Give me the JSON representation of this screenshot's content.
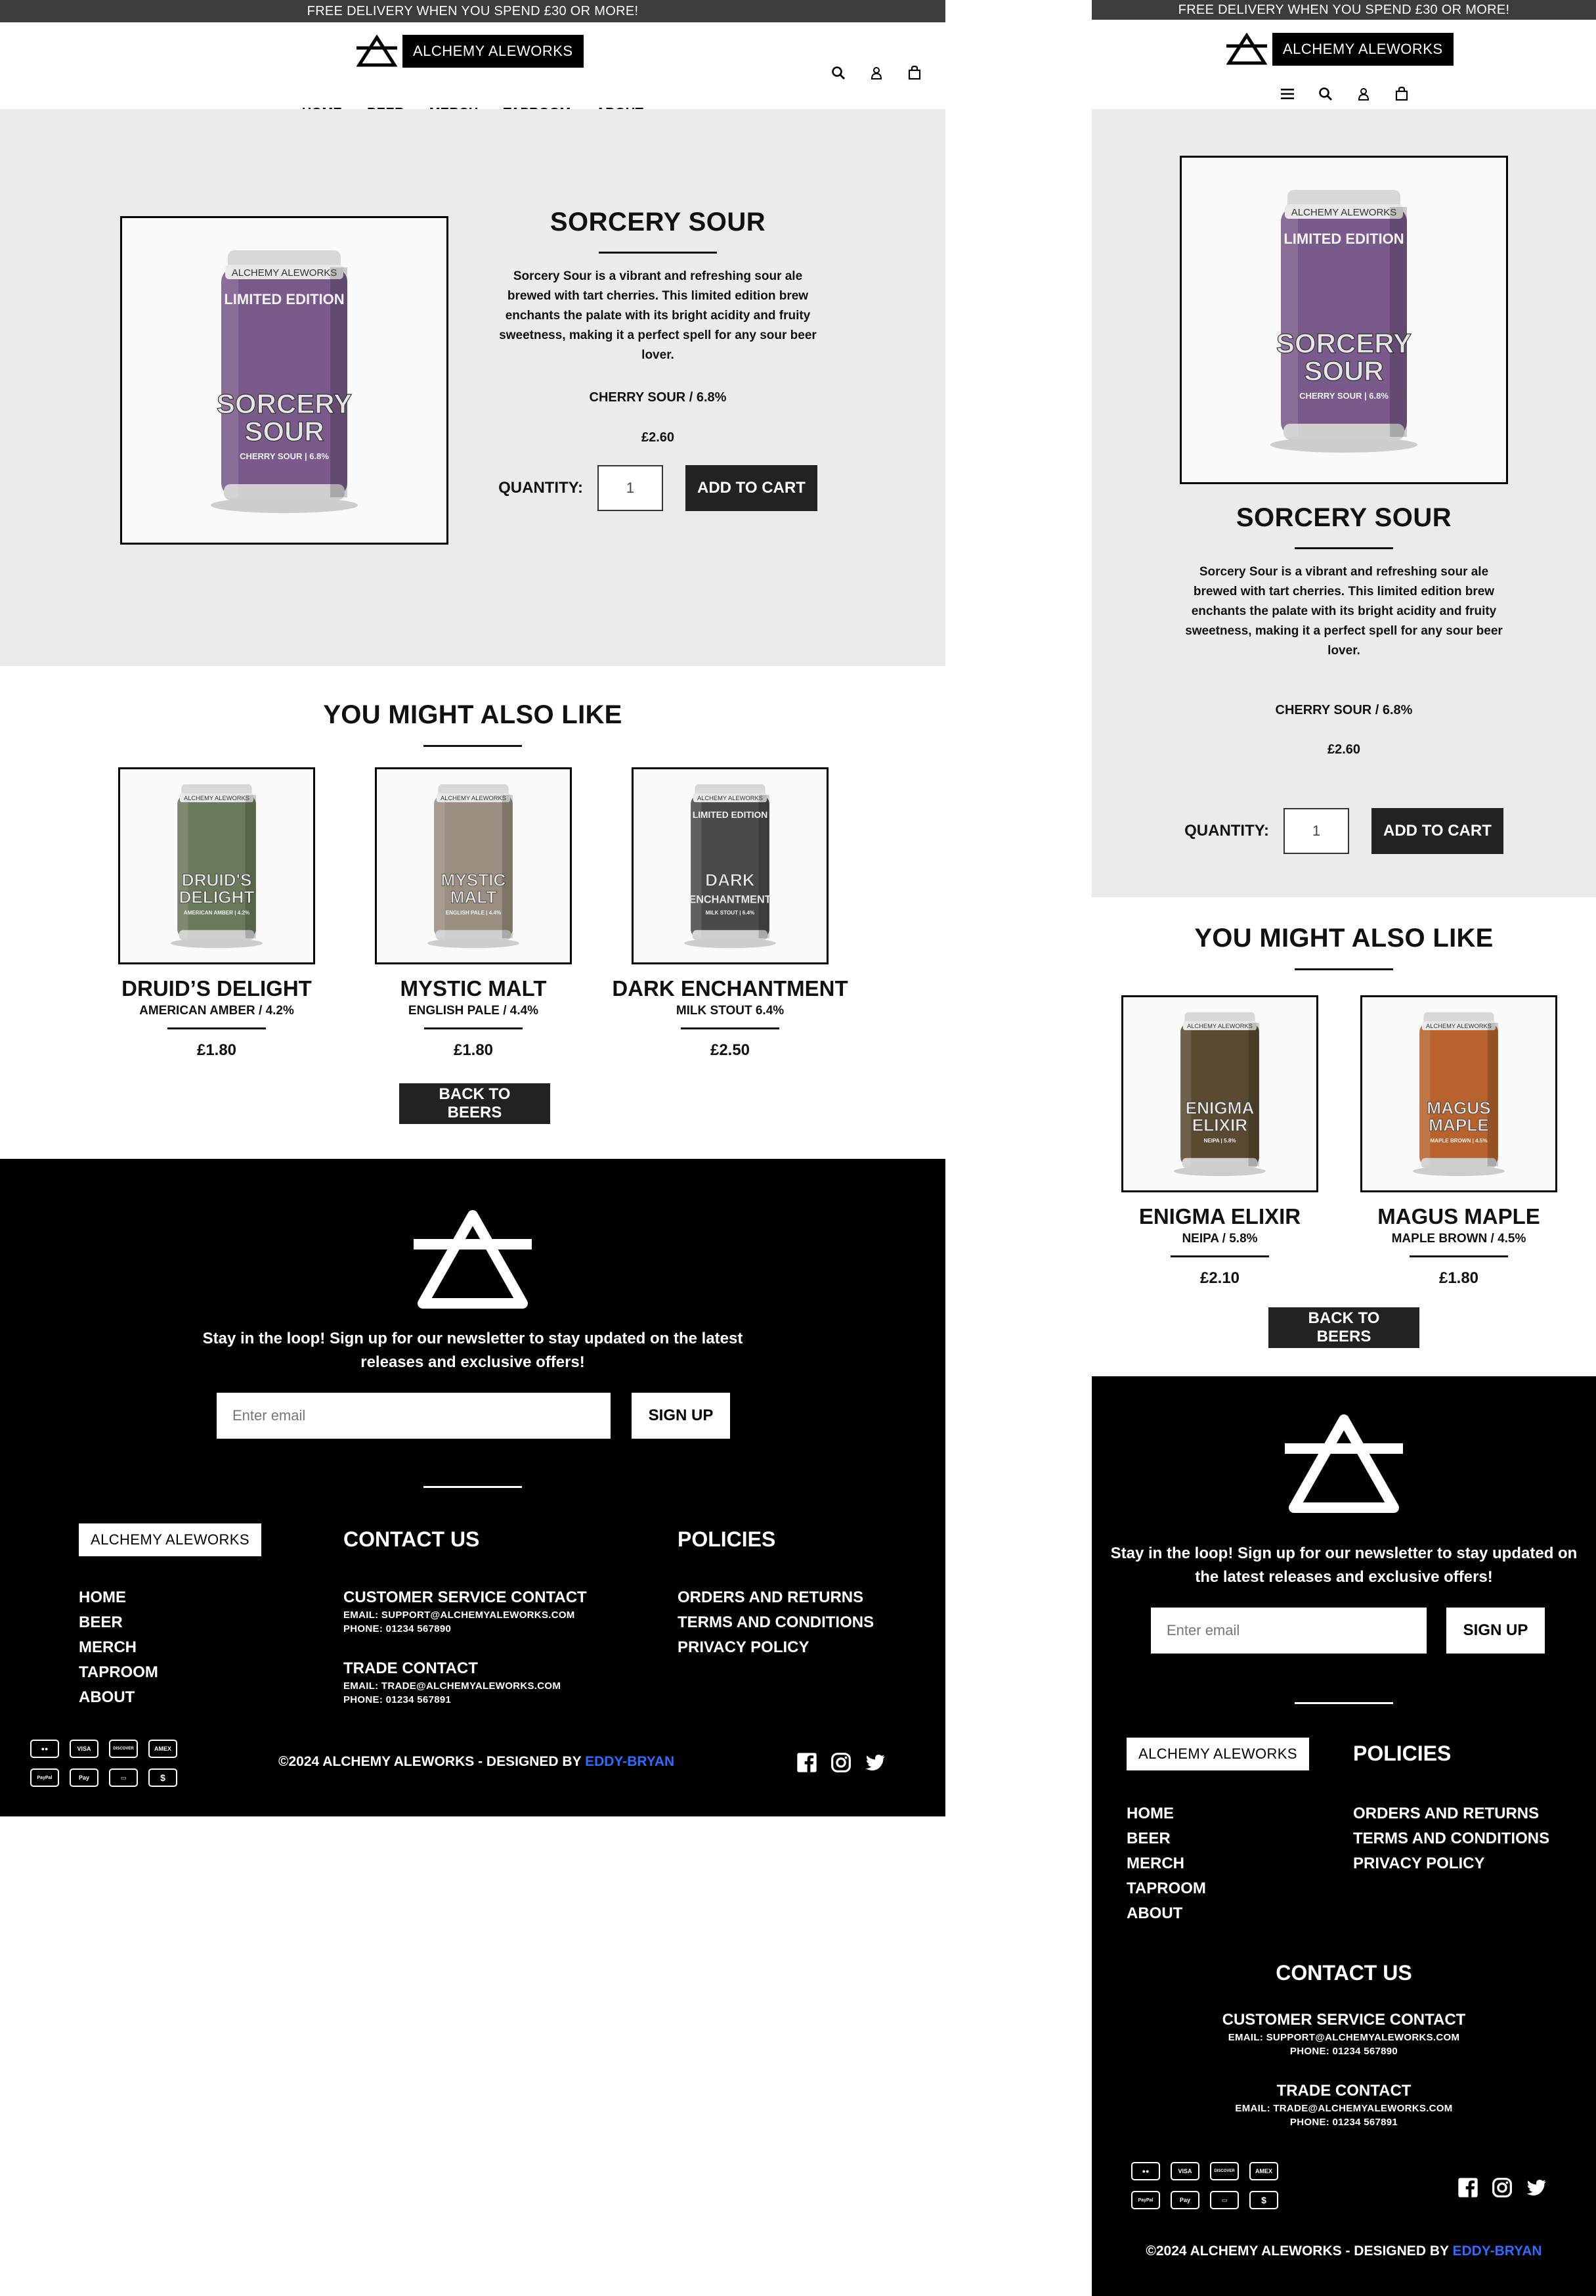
{
  "promo_text": "FREE DELIVERY WHEN YOU SPEND £30 OR MORE!",
  "brand": "ALCHEMY ALEWORKS",
  "icons": {
    "search": "search-icon",
    "account": "user-icon",
    "cart": "bag-icon",
    "menu": "hamburger-icon"
  },
  "nav": [
    "HOME",
    "BEER",
    "MERCH",
    "TAPROOM",
    "ABOUT"
  ],
  "product": {
    "title": "SORCERY SOUR",
    "description": "Sorcery Sour is a vibrant and refreshing sour ale brewed with tart cherries. This limited edition brew enchants the palate with its bright acidity and fruity sweetness, making it a perfect spell for any sour beer lover.",
    "style": "CHERRY SOUR / 6.8%",
    "price": "£2.60",
    "quantity_label": "QUANTITY:",
    "quantity_value": "1",
    "add_to_cart": "ADD TO CART",
    "can_brand": "ALCHEMY ALEWORKS",
    "can_edition": "LIMITED EDITION",
    "can_name_1": "SORCERY",
    "can_name_2": "SOUR",
    "can_sub": "CHERRY SOUR | 6.8%",
    "can_color": "#7a5a8a"
  },
  "related": {
    "title": "YOU MIGHT ALSO LIKE",
    "back_button": "BACK TO BEERS",
    "desktop_items": [
      {
        "name": "DRUID’S DELIGHT",
        "style": "AMERICAN AMBER / 4.2%",
        "price": "£1.80",
        "can_name_1": "DRUID'S",
        "can_name_2": "DELIGHT",
        "can_sub": "AMERICAN AMBER | 4.2%",
        "color": "#6b7a5a",
        "edition": ""
      },
      {
        "name": "MYSTIC MALT",
        "style": "ENGLISH PALE / 4.4%",
        "price": "£1.80",
        "can_name_1": "MYSTIC",
        "can_name_2": "MALT",
        "can_sub": "ENGLISH PALE | 4.4%",
        "color": "#9a8f80",
        "edition": ""
      },
      {
        "name": "DARK ENCHANTMENT",
        "style": "MILK STOUT 6.4%",
        "price": "£2.50",
        "can_name_1": "DARK",
        "can_name_2": "ENCHANTMENT",
        "can_sub": "MILK STOUT | 6.4%",
        "color": "#4a4a4a",
        "edition": "LIMITED EDITION"
      }
    ],
    "mobile_items": [
      {
        "name": "ENIGMA ELIXIR",
        "style": "NEIPA / 5.8%",
        "price": "£2.10",
        "can_name_1": "ENIGMA",
        "can_name_2": "ELIXIR",
        "can_sub": "NEIPA | 5.8%",
        "color": "#5a4a30",
        "edition": ""
      },
      {
        "name": "MAGUS MAPLE",
        "style": "MAPLE BROWN / 4.5%",
        "price": "£1.80",
        "can_name_1": "MAGUS",
        "can_name_2": "MAPLE",
        "can_sub": "MAPLE BROWN | 4.5%",
        "color": "#b8632e",
        "edition": ""
      }
    ]
  },
  "footer": {
    "newsletter_text": "Stay in the loop! Sign up for our newsletter to stay updated on the latest releases and exclusive offers!",
    "email_placeholder": "Enter email",
    "signup_button": "SIGN UP",
    "contact_heading": "CONTACT US",
    "policies_heading": "POLICIES",
    "links": [
      "HOME",
      "BEER",
      "MERCH",
      "TAPROOM",
      "ABOUT"
    ],
    "customer_service": {
      "title": "CUSTOMER SERVICE CONTACT",
      "email": "EMAIL: SUPPORT@ALCHEMYALEWORKS.COM",
      "phone": "PHONE: 01234 567890"
    },
    "trade": {
      "title": "TRADE CONTACT",
      "email": "EMAIL: TRADE@ALCHEMYALEWORKS.COM",
      "phone": "PHONE: 01234 567891"
    },
    "policies": [
      "ORDERS AND RETURNS",
      "TERMS AND CONDITIONS",
      "PRIVACY POLICY"
    ],
    "payment_methods": [
      "Mastercard",
      "VISA",
      "DISCOVER",
      "AMEX",
      "PayPal",
      "Apple Pay",
      "Card",
      "$"
    ],
    "social": [
      "facebook-icon",
      "instagram-icon",
      "twitter-icon"
    ],
    "copyright_prefix": "©2024 ALCHEMY ALEWORKS - DESIGNED BY ",
    "designer": "EDDY-BRYAN",
    "designer_color": "#2e6bff"
  }
}
